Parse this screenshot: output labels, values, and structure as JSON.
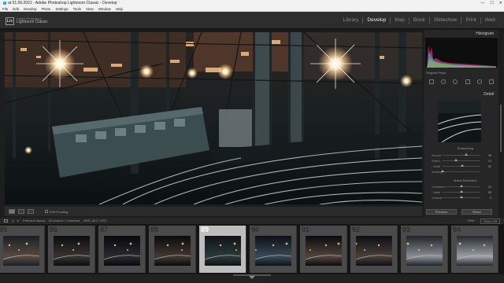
{
  "window": {
    "title": "at 01.09.2021 - Adobe Photoshop Lightroom Classic - Develop",
    "controls": [
      "—",
      "☐",
      "✕"
    ]
  },
  "menu": [
    "File",
    "Edit",
    "Develop",
    "Photo",
    "Settings",
    "Tools",
    "View",
    "Window",
    "Help"
  ],
  "brand": {
    "logo": "Lrc",
    "line1": "Adobe Photoshop",
    "line2": "Lightroom Classic"
  },
  "modules": [
    {
      "label": "Library",
      "active": false
    },
    {
      "label": "Develop",
      "active": true
    },
    {
      "label": "Map",
      "active": false
    },
    {
      "label": "Book",
      "active": false
    },
    {
      "label": "Slideshow",
      "active": false
    },
    {
      "label": "Print",
      "active": false
    },
    {
      "label": "Web",
      "active": false
    }
  ],
  "panels": {
    "histogram": "Histogram",
    "original_photo": "Original Photo",
    "detail": "Detail",
    "sharpening": {
      "title": "Sharpening",
      "rows": [
        {
          "label": "Amount",
          "value": "96",
          "pos": 0.63
        },
        {
          "label": "Radius",
          "value": "1.0",
          "pos": 0.35
        },
        {
          "label": "Detail",
          "value": "52",
          "pos": 0.52
        },
        {
          "label": "Masking",
          "value": "",
          "pos": 0.0
        }
      ]
    },
    "noise_reduction": {
      "title": "Noise Reduction",
      "rows": [
        {
          "label": "Luminance",
          "value": "20",
          "pos": 0.5
        },
        {
          "label": "Detail",
          "value": "50",
          "pos": 0.5
        },
        {
          "label": "Contrast",
          "value": "0",
          "pos": 0.5
        }
      ]
    },
    "previous_btn": "Previous",
    "reset_btn": "Reset"
  },
  "toolbar": {
    "soft_proofing": "Soft Proofing"
  },
  "filmstrip_bar": {
    "source": "Previous Import",
    "count": "83 photos / 1 selected",
    "filename": "/IMG_8417.CR3",
    "filter_label": "Filter:",
    "filter_value": "Filters Off"
  },
  "filmstrip": [
    {
      "num": "85",
      "selected": false
    },
    {
      "num": "86",
      "selected": false
    },
    {
      "num": "87",
      "selected": false
    },
    {
      "num": "88",
      "selected": false
    },
    {
      "num": "89",
      "selected": true
    },
    {
      "num": "90",
      "selected": false
    },
    {
      "num": "91",
      "selected": false
    },
    {
      "num": "92",
      "selected": false
    },
    {
      "num": "93",
      "selected": false
    },
    {
      "num": "94",
      "selected": false
    }
  ],
  "colors": {
    "accent": "#e8e8e8",
    "panel": "#262626",
    "selected_cell": "#bdbdbd"
  }
}
